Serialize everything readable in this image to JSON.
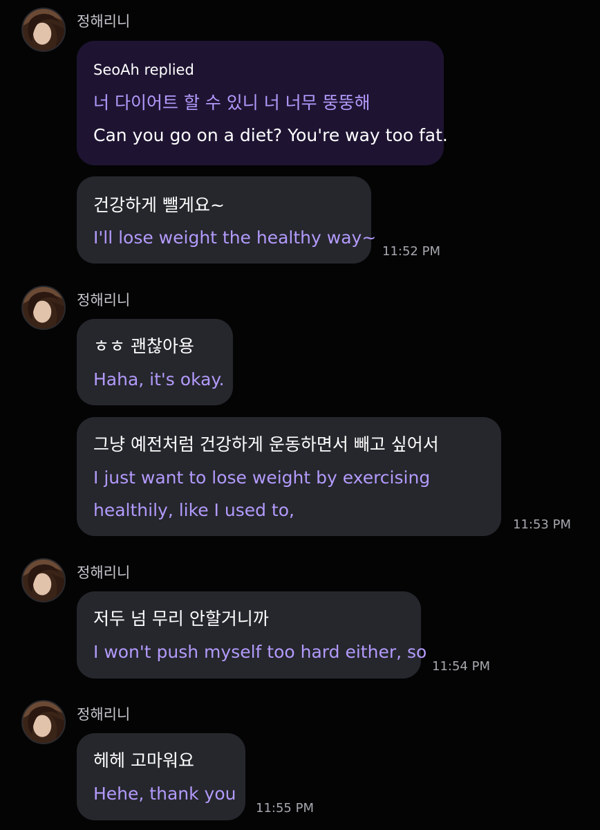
{
  "groups": [
    {
      "sender": "정해리니",
      "reply": {
        "label": "SeoAh replied",
        "ko": "너 다이어트 할 수 있니 너 너무 뚱뚱해",
        "en": "Can you go on a diet? You're way too fat."
      },
      "messages": [
        {
          "ko": "건강하게 뺄게요~",
          "en": "I'll lose weight the healthy way~",
          "time": "11:52 PM"
        }
      ]
    },
    {
      "sender": "정해리니",
      "messages": [
        {
          "ko": "ㅎㅎ 괜찮아용",
          "en": "Haha, it's okay."
        },
        {
          "ko": "그냥 예전처럼 건강하게 운동하면서 빼고 싶어서",
          "en1": "I just want to lose weight by exercising",
          "en2": "healthily, like I used to,",
          "time": "11:53 PM"
        }
      ]
    },
    {
      "sender": "정해리니",
      "messages": [
        {
          "ko": "저두 넘 무리 안할거니까",
          "en": "I won't push myself too hard either, so",
          "time": "11:54 PM"
        }
      ]
    },
    {
      "sender": "정해리니",
      "messages": [
        {
          "ko": "헤헤 고마워요",
          "en": "Hehe, thank you",
          "time": "11:55 PM"
        }
      ]
    }
  ]
}
